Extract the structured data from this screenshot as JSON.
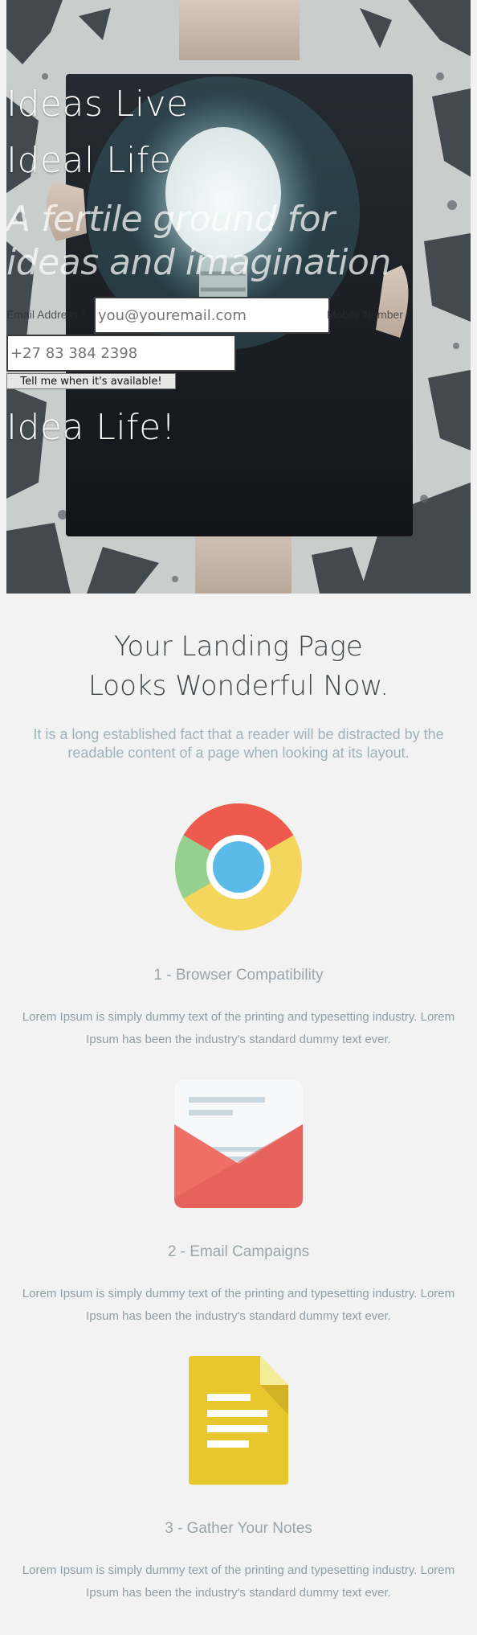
{
  "hero": {
    "headline_line1": "Ideas Live",
    "headline_line2": "Ideal Life",
    "tagline": "A fertile ground for ideas and imagination",
    "form": {
      "email_label": "Email Address *",
      "email_placeholder": "you@youremail.com",
      "mobile_label": "Mobile Number",
      "mobile_placeholder": "+27 83 384 2398",
      "submit_label": "Tell me when it's available!"
    },
    "closing_headline": "Idea Life!"
  },
  "content": {
    "title_line1": "Your Landing Page",
    "title_line2": "Looks Wonderful Now.",
    "intro": "It is a long established fact that a reader will be distracted by the readable content of a page when looking at its layout.",
    "features": [
      {
        "icon": "chrome-browser-icon",
        "title": "1 - Browser Compatibility",
        "description": "Lorem Ipsum is simply dummy text of the printing and typesetting industry. Lorem Ipsum has been the industry's standard dummy text ever."
      },
      {
        "icon": "envelope-icon",
        "title": "2 - Email Campaigns",
        "description": "Lorem Ipsum is simply dummy text of the printing and typesetting industry. Lorem Ipsum has been the industry's standard dummy text ever."
      },
      {
        "icon": "document-notes-icon",
        "title": "3 - Gather Your Notes",
        "description": "Lorem Ipsum is simply dummy text of the printing and typesetting industry. Lorem Ipsum has been the industry's standard dummy text ever."
      }
    ]
  },
  "colors": {
    "page_background": "#f2f2f2",
    "title_text": "#3e4549",
    "muted_text": "#9eb2ba",
    "chrome_red": "#ef5a4f",
    "chrome_yellow": "#f3d65b",
    "chrome_green": "#95d08f",
    "chrome_blue": "#5bbbe8",
    "envelope_red": "#e8625a",
    "notes_yellow": "#e8c72c"
  }
}
